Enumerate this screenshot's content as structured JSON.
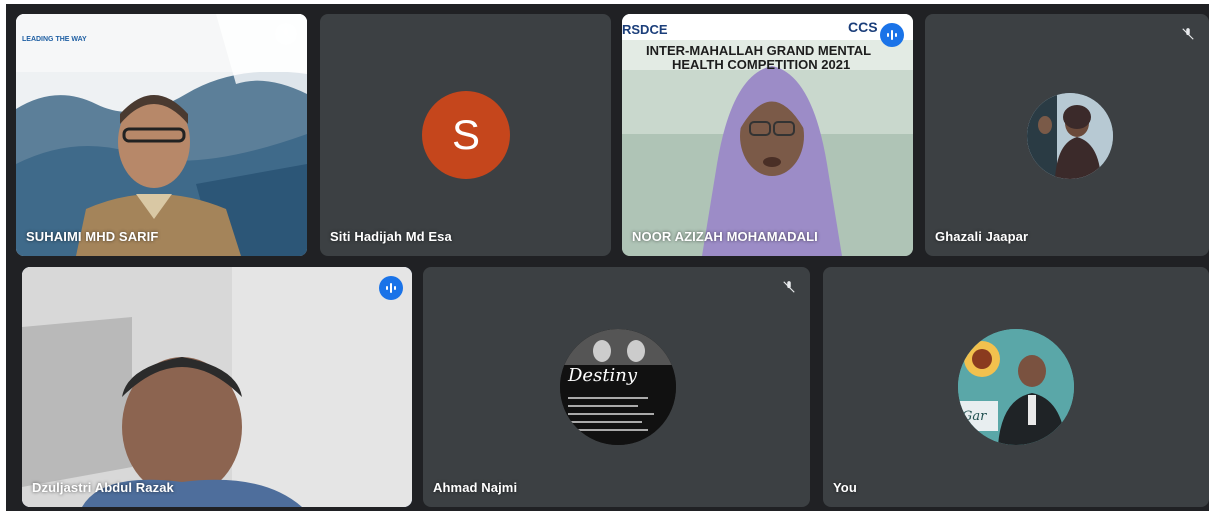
{
  "participants": [
    {
      "name": "SUHAIMI MHD SARIF",
      "muted": true,
      "has_video": true,
      "banner": "LEADING THE WAY"
    },
    {
      "name": "Siti Hadijah Md Esa",
      "muted": false,
      "has_video": false,
      "avatar_letter": "S",
      "avatar_color": "#c5461c"
    },
    {
      "name": "NOOR AZIZAH MOHAMADALI",
      "muted": false,
      "speaking": true,
      "has_video": true,
      "banner_org": "RSDCE",
      "banner_title_1": "INTER-MAHALLAH GRAND MENTAL",
      "banner_title_2": "HEALTH COMPETITION 2021",
      "banner_tag": "CCS"
    },
    {
      "name": "Ghazali Jaapar",
      "muted": true,
      "has_video": false
    },
    {
      "name": "Dzuljastri Abdul Razak",
      "muted": false,
      "speaking": true,
      "active": true,
      "has_video": true
    },
    {
      "name": "Ahmad Najmi",
      "muted": true,
      "has_video": false,
      "avatar_text": "Destiny"
    },
    {
      "name": "You",
      "muted": false,
      "has_video": false,
      "avatar_text": "Gar"
    }
  ],
  "colors": {
    "tile_bg": "#3c4043",
    "grid_bg": "#202124",
    "speaking": "#1a73e8",
    "active_outline": "#8ab4f8"
  }
}
